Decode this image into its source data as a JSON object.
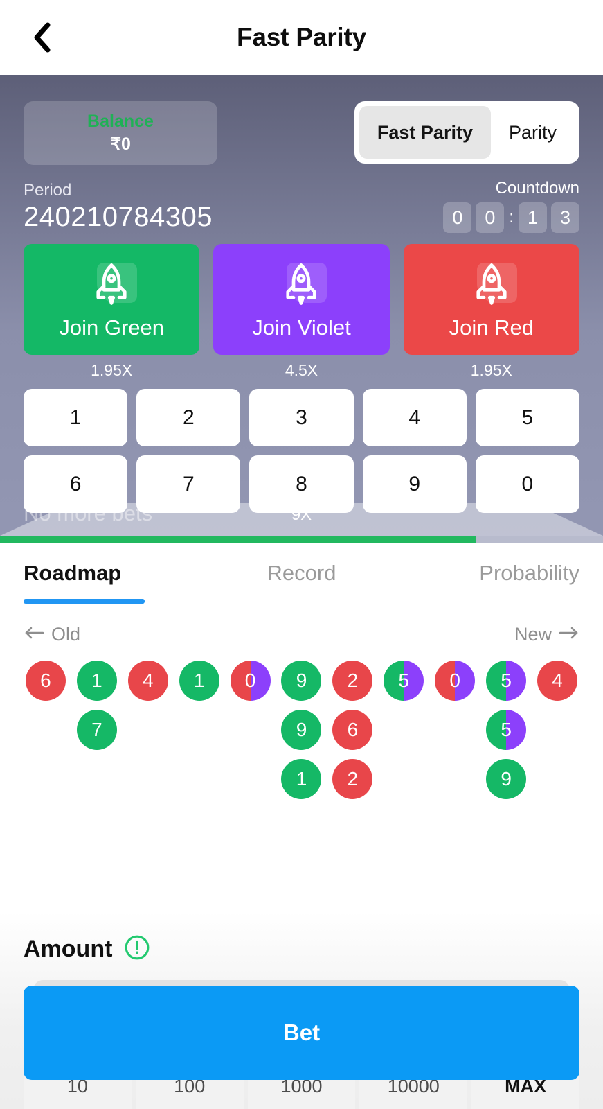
{
  "header": {
    "title": "Fast Parity",
    "back_icon": "chevron-left-icon"
  },
  "panel": {
    "balance": {
      "label": "Balance",
      "value": "₹0"
    },
    "mode_toggle": {
      "active": "Fast Parity",
      "inactive": "Parity"
    },
    "period": {
      "label": "Period",
      "value": "240210784305"
    },
    "countdown": {
      "label": "Countdown",
      "digits": [
        "0",
        "0",
        "1",
        "3"
      ],
      "separator": ":"
    },
    "join_buttons": [
      {
        "label": "Join Green",
        "multiplier": "1.95X",
        "color": "#14b866",
        "icon": "rocket-icon"
      },
      {
        "label": "Join Violet",
        "multiplier": "4.5X",
        "color": "#8c40fb",
        "icon": "rocket-icon"
      },
      {
        "label": "Join Red",
        "multiplier": "1.95X",
        "color": "#eb4848",
        "icon": "rocket-icon"
      }
    ],
    "numbers": [
      "1",
      "2",
      "3",
      "4",
      "5",
      "6",
      "7",
      "8",
      "9",
      "0"
    ],
    "number_multiplier": "9X",
    "no_more_bets": "No more bets",
    "progress_percent": 79,
    "progress_color": "#22b85f"
  },
  "tabs": [
    {
      "label": "Roadmap",
      "active": true
    },
    {
      "label": "Record",
      "active": false
    },
    {
      "label": "Probability",
      "active": false
    }
  ],
  "roadmap": {
    "old_label": "Old",
    "new_label": "New",
    "old_icon": "arrow-left-icon",
    "new_icon": "arrow-right-icon",
    "columns": [
      [
        {
          "value": "6",
          "color": "red"
        }
      ],
      [
        {
          "value": "1",
          "color": "green"
        },
        {
          "value": "7",
          "color": "green"
        }
      ],
      [
        {
          "value": "4",
          "color": "red"
        }
      ],
      [
        {
          "value": "1",
          "color": "green"
        }
      ],
      [
        {
          "value": "0",
          "color": "red-violet"
        }
      ],
      [
        {
          "value": "9",
          "color": "green"
        },
        {
          "value": "9",
          "color": "green"
        },
        {
          "value": "1",
          "color": "green"
        }
      ],
      [
        {
          "value": "2",
          "color": "red"
        },
        {
          "value": "6",
          "color": "red"
        },
        {
          "value": "2",
          "color": "red"
        }
      ],
      [
        {
          "value": "5",
          "color": "green-violet"
        }
      ],
      [
        {
          "value": "0",
          "color": "red-violet"
        }
      ],
      [
        {
          "value": "5",
          "color": "green-violet"
        },
        {
          "value": "5",
          "color": "green-violet"
        },
        {
          "value": "9",
          "color": "green"
        }
      ],
      [
        {
          "value": "4",
          "color": "red"
        }
      ]
    ]
  },
  "amount": {
    "title": "Amount",
    "warning_icon": "exclamation-circle-icon",
    "bet_label": "Bet",
    "quick_amounts": [
      "10",
      "100",
      "1000",
      "10000",
      "MAX"
    ]
  }
}
